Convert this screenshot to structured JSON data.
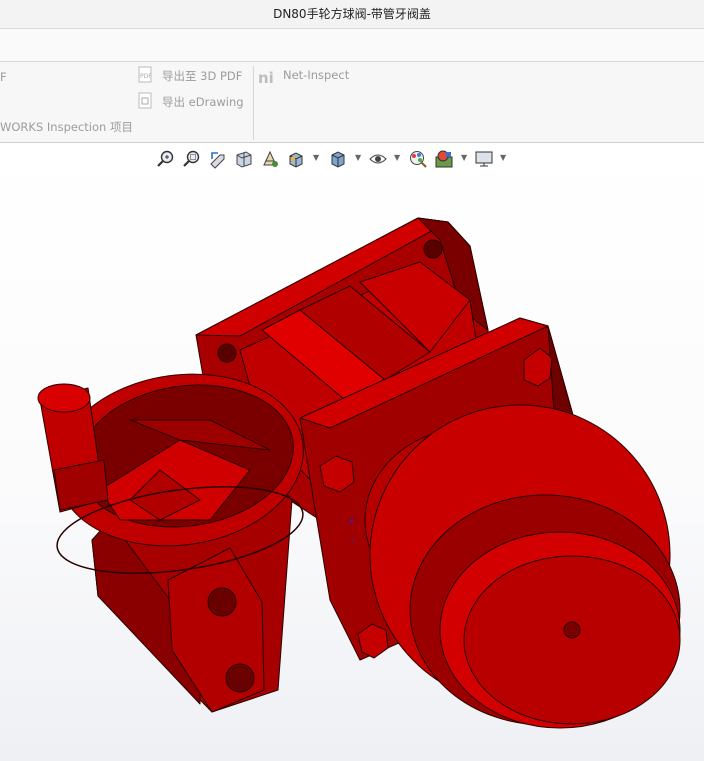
{
  "window": {
    "title": "DN80手轮方球阀-带管牙阀盖"
  },
  "ribbon": {
    "cut_label": "F",
    "export_3dpdf": "导出至 3D PDF",
    "export_edrawing": "导出 eDrawing",
    "inspection_project": "WORKS Inspection 项目",
    "net_inspect": "Net-Inspect"
  },
  "heads_up_toolbar": {
    "tools": [
      "zoom-to-fit-icon",
      "zoom-to-area-icon",
      "previous-view-icon",
      "section-view-icon",
      "dynamic-annotation-icon",
      "view-orientation-icon",
      "display-style-icon",
      "hide-show-items-icon",
      "edit-appearance-icon",
      "apply-scene-icon",
      "view-settings-icon"
    ]
  },
  "model": {
    "name": "DN80 handwheel square ball valve",
    "color": "#c40000",
    "color_dark": "#6f0000",
    "color_edge": "#2a0000"
  },
  "colors": {
    "ribbon_text": "#9c9c9c",
    "titlebar": "#f3f3f3"
  }
}
